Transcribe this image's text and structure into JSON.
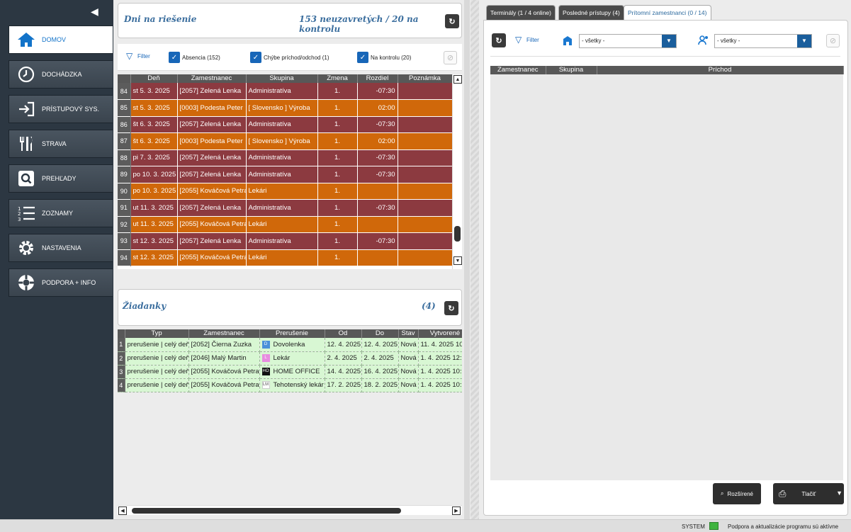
{
  "sidebar": {
    "items": [
      {
        "label": "DOMOV",
        "icon": "home-icon"
      },
      {
        "label": "DOCHÁDZKA",
        "icon": "clock-icon"
      },
      {
        "label": "PRÍSTUPOVÝ SYS.",
        "icon": "login-arrow-icon"
      },
      {
        "label": "STRAVA",
        "icon": "cutlery-icon"
      },
      {
        "label": "PREHĽADY",
        "icon": "search-icon"
      },
      {
        "label": "ZOZNAMY",
        "icon": "numbered-list-icon"
      },
      {
        "label": "NASTAVENIA",
        "icon": "gear-icon"
      },
      {
        "label": "PODPORA + INFO",
        "icon": "lifebuoy-icon"
      }
    ]
  },
  "days": {
    "title": "Dni na riešenie",
    "summary": "153 neuzavretých / 20 na kontrolu",
    "filter_label": "Filter",
    "checks": [
      "Absencia (152)",
      "Chýbe príchod/odchod (1)",
      "Na kontrolu (20)"
    ],
    "columns": [
      "Deň",
      "Zamestnanec",
      "Skupina",
      "Zmena",
      "Rozdiel",
      "Poznámka"
    ],
    "rows": [
      {
        "n": "84",
        "day": "st 5. 3. 2025",
        "emp": "[2057] Zelená Lenka",
        "grp": "Administratíva",
        "shift": "1.",
        "diff": "-07:30",
        "type": "a"
      },
      {
        "n": "85",
        "day": "st 5. 3. 2025",
        "emp": "[0003] Podesta Peter",
        "grp": "[ Slovensko ] Výroba",
        "shift": "1.",
        "diff": "02:00",
        "type": "b"
      },
      {
        "n": "86",
        "day": "št 6. 3. 2025",
        "emp": "[2057] Zelená Lenka",
        "grp": "Administratíva",
        "shift": "1.",
        "diff": "-07:30",
        "type": "a"
      },
      {
        "n": "87",
        "day": "št 6. 3. 2025",
        "emp": "[0003] Podesta Peter",
        "grp": "[ Slovensko ] Výroba",
        "shift": "1.",
        "diff": "02:00",
        "type": "b"
      },
      {
        "n": "88",
        "day": "pi 7. 3. 2025",
        "emp": "[2057] Zelená Lenka",
        "grp": "Administratíva",
        "shift": "1.",
        "diff": "-07:30",
        "type": "a"
      },
      {
        "n": "89",
        "day": "po 10. 3. 2025",
        "emp": "[2057] Zelená Lenka",
        "grp": "Administratíva",
        "shift": "1.",
        "diff": "-07:30",
        "type": "a"
      },
      {
        "n": "90",
        "day": "po 10. 3. 2025",
        "emp": "[2055] Kováčová Petra",
        "grp": "Lekári",
        "shift": "1.",
        "diff": "",
        "type": "b"
      },
      {
        "n": "91",
        "day": "ut 11. 3. 2025",
        "emp": "[2057] Zelená Lenka",
        "grp": "Administratíva",
        "shift": "1.",
        "diff": "-07:30",
        "type": "a"
      },
      {
        "n": "92",
        "day": "ut 11. 3. 2025",
        "emp": "[2055] Kováčová Petra",
        "grp": "Lekári",
        "shift": "1.",
        "diff": "",
        "type": "b"
      },
      {
        "n": "93",
        "day": "st 12. 3. 2025",
        "emp": "[2057] Zelená Lenka",
        "grp": "Administratíva",
        "shift": "1.",
        "diff": "-07:30",
        "type": "a"
      },
      {
        "n": "94",
        "day": "st 12. 3. 2025",
        "emp": "[2055] Kováčová Petra",
        "grp": "Lekári",
        "shift": "1.",
        "diff": "",
        "type": "b"
      }
    ]
  },
  "requests": {
    "title": "Žiadanky",
    "count": "(4)",
    "columns": [
      "Typ",
      "Zamestnanec",
      "Prerušenie",
      "Od",
      "Do",
      "Stav",
      "Vytvorené"
    ],
    "rows": [
      {
        "n": "1",
        "type": "prerušenie | celý deň",
        "emp": "[2052] Čierna Zuzka",
        "badge": "D",
        "badge_color": "#4a90d9",
        "reason": "Dovolenka",
        "from": "12. 4. 2025",
        "to": "12. 4. 2025",
        "state": "Nová",
        "created": "11. 4. 2025  10"
      },
      {
        "n": "2",
        "type": "prerušenie | celý deň",
        "emp": "[2046] Malý Martin",
        "badge": "L",
        "badge_color": "#e88ce0",
        "reason": "Lekár",
        "from": "2. 4. 2025",
        "to": "2. 4. 2025",
        "state": "Nová",
        "created": "1. 4. 2025  12:5"
      },
      {
        "n": "3",
        "type": "prerušenie | celý deň",
        "emp": "[2055] Kováčová Petra",
        "badge": "HO",
        "badge_color": "#111111",
        "reason": "HOME OFFICE",
        "from": "14. 4. 2025",
        "to": "16. 4. 2025",
        "state": "Nová",
        "created": "1. 4. 2025  10:1"
      },
      {
        "n": "4",
        "type": "prerušenie | celý deň",
        "emp": "[2055] Kováčová Petra",
        "badge": "LM",
        "badge_color": "#ffffff",
        "reason": "Tehotenský lekár",
        "from": "17. 2. 2025",
        "to": "18. 2. 2025",
        "state": "Nová",
        "created": "1. 4. 2025  10:0"
      }
    ]
  },
  "right": {
    "tabs": [
      "Terminály (1 / 4 online)",
      "Posledné prístupy (4)",
      "Prítomní zamestnanci (0 / 14)"
    ],
    "filter_label": "Filter",
    "select1": "- všetky -",
    "select2": "- všetky -",
    "columns": [
      "Zamestnanec",
      "Skupina",
      "Príchod"
    ],
    "advanced_label": "Rozšírené",
    "print_label": "Tlačiť"
  },
  "status": {
    "user": "SYSTEM",
    "message": "Podpora a aktualizácie programu sú aktívne"
  }
}
